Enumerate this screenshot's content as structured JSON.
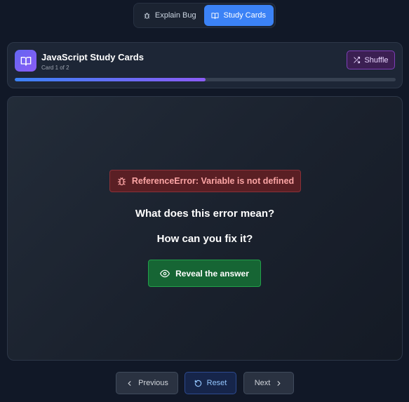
{
  "mode_switch": {
    "explain_label": "Explain Bug",
    "study_label": "Study Cards",
    "active": "Study Cards",
    "explain_icon": "bug-icon",
    "study_icon": "book-open-icon"
  },
  "header": {
    "title": "JavaScript Study Cards",
    "subtitle": "Card 1 of 2",
    "app_icon": "book-open-icon",
    "shuffle_label": "Shuffle",
    "shuffle_icon": "shuffle-icon",
    "progress": 0.5
  },
  "card": {
    "error_label": "ReferenceError: Variable is not defined",
    "error_icon": "bug-icon",
    "question_line1": "What does this error mean?",
    "question_line2": "How can you fix it?",
    "reveal_label": "Reveal the answer",
    "reveal_icon": "eye-icon"
  },
  "nav": {
    "previous_label": "Previous",
    "reset_label": "Reset",
    "next_label": "Next"
  },
  "colors": {
    "background": "#111827",
    "accent_blue": "#3b82f6",
    "accent_purple": "#8b5cf6",
    "error_red": "#fca5a5",
    "success_green": "#166534"
  }
}
